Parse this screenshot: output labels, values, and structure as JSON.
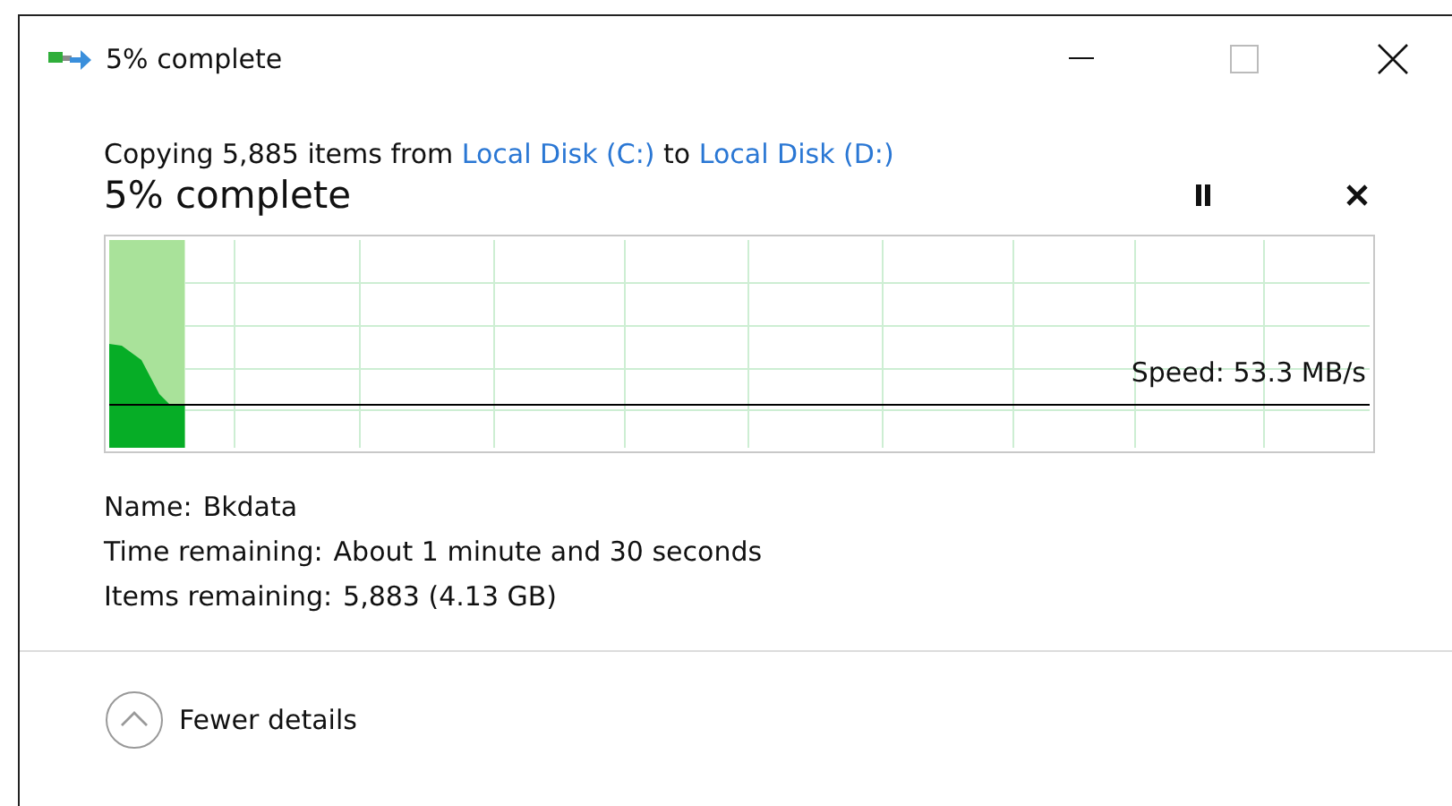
{
  "window": {
    "title": "5% complete"
  },
  "copy": {
    "prefix": "Copying 5,885 items from",
    "source": "Local Disk (C:)",
    "middle": "to",
    "destination": "Local Disk (D:)"
  },
  "status": "5% complete",
  "progress": {
    "level": 0.06,
    "speed": "Speed: 53.3 MB/s"
  },
  "details": [
    {
      "label": "Name:",
      "value": "Bkdata"
    },
    {
      "label": "Time remaining:",
      "value": "About 1 minute and 30 seconds"
    },
    {
      "label": "Items remaining:",
      "value": "5,883 (4.13 GB)"
    }
  ],
  "toggle": {
    "label": "Fewer details",
    "expanded": true
  }
}
